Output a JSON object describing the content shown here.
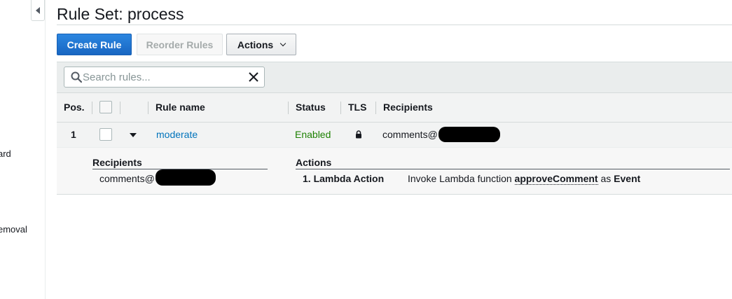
{
  "sidebar": {
    "toggle_icon": "caret-left-icon",
    "partial_items": [
      "ard",
      "emoval"
    ]
  },
  "page": {
    "title": "Rule Set: process"
  },
  "toolbar": {
    "create_rule": "Create Rule",
    "reorder_rules": "Reorder Rules",
    "actions": "Actions"
  },
  "search": {
    "placeholder": "Search rules...",
    "value": ""
  },
  "table": {
    "columns": {
      "pos": "Pos.",
      "rule_name": "Rule name",
      "status": "Status",
      "tls": "TLS",
      "recipients": "Recipients"
    },
    "rows": [
      {
        "pos": "1",
        "rule_name": "moderate",
        "status": "Enabled",
        "tls_icon": "lock-icon",
        "recipients": "comments@"
      }
    ],
    "detail": {
      "recipients_heading": "Recipients",
      "recipients_value": "comments@",
      "actions_heading": "Actions",
      "action_name": "1. Lambda Action",
      "action_desc_prefix": "Invoke Lambda function ",
      "action_function": "approveComment",
      "action_desc_mid": " as ",
      "action_invocation": "Event"
    }
  },
  "colors": {
    "primary": "#1a73d0",
    "link": "#0073bb",
    "enabled": "#1d8102",
    "header_bg": "#f2f3f3"
  }
}
